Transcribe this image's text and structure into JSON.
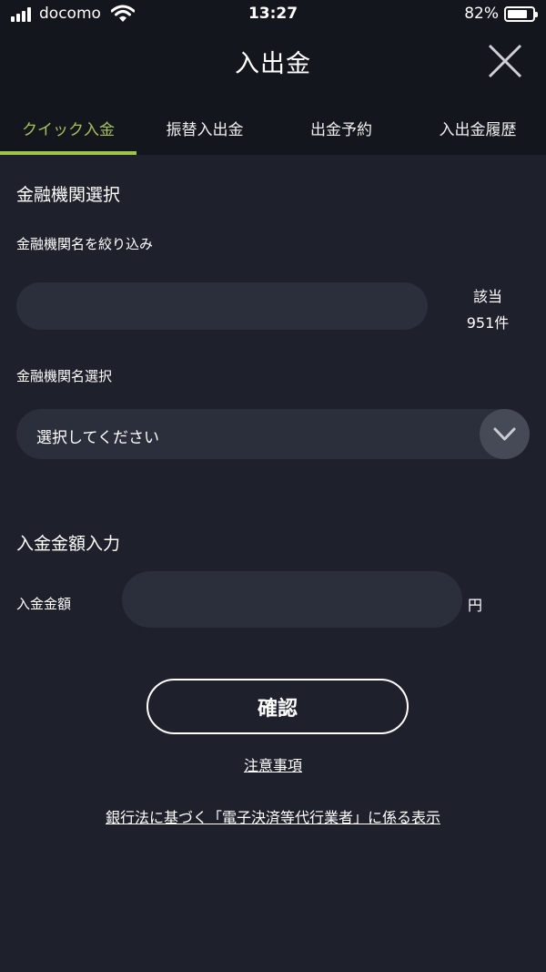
{
  "status_bar": {
    "carrier": "docomo",
    "time": "13:27",
    "battery_percent": "82%",
    "battery_level": 0.82,
    "icons": [
      "signal-icon",
      "wifi-icon",
      "battery-icon"
    ]
  },
  "header": {
    "title": "入出金",
    "close_icon": "close-icon"
  },
  "tabs": [
    {
      "label": "クイック入金",
      "active": true
    },
    {
      "label": "振替入出金",
      "active": false
    },
    {
      "label": "出金予約",
      "active": false
    },
    {
      "label": "入出金履歴",
      "active": false
    }
  ],
  "bank_section": {
    "title": "金融機関選択",
    "filter_label": "金融機関名を絞り込み",
    "filter_value": "",
    "match_label": "該当",
    "match_count": "951件",
    "select_label": "金融機関名選択",
    "select_value": "選択してください",
    "select_icon": "chevron-down-icon"
  },
  "amount_section": {
    "title": "入金金額入力",
    "amount_label": "入金金額",
    "amount_value": "",
    "currency": "円"
  },
  "actions": {
    "confirm_label": "確認",
    "notes_link": "注意事項",
    "legal_link": "銀行法に基づく「電子決済等代行業者」に係る表示"
  },
  "colors": {
    "background": "#1e212b",
    "header_background": "#14161d",
    "accent": "#9ec54b",
    "field": "#2b2e3b"
  }
}
